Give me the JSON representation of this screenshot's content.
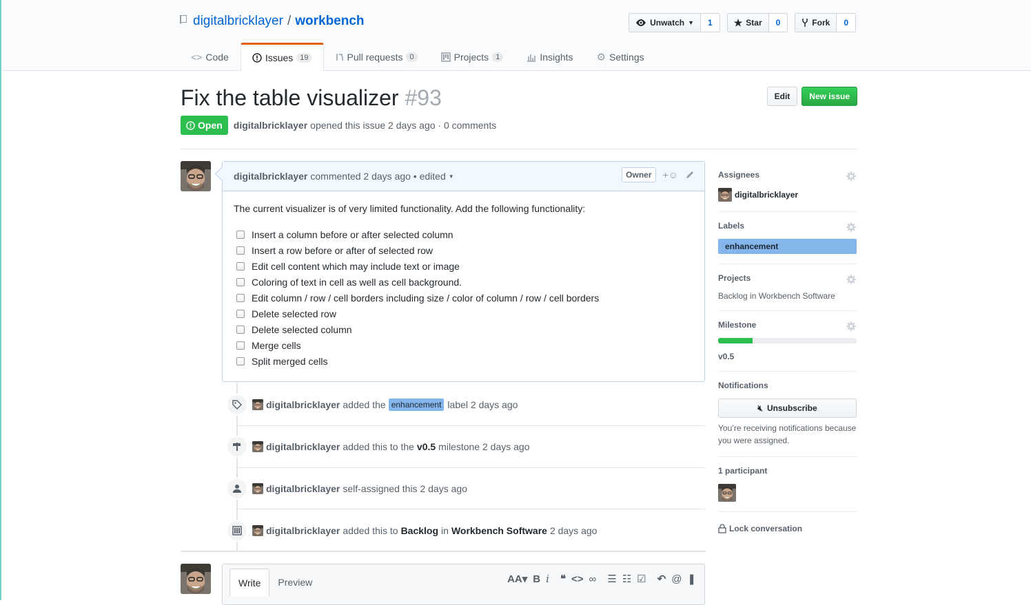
{
  "repo": {
    "owner": "digitalbricklayer",
    "separator": "/",
    "name": "workbench"
  },
  "actions": {
    "watch": {
      "label": "Unwatch",
      "count": "1"
    },
    "star": {
      "label": "Star",
      "count": "0"
    },
    "fork": {
      "label": "Fork",
      "count": "0"
    }
  },
  "nav": [
    {
      "label": "Code"
    },
    {
      "label": "Issues",
      "counter": "19"
    },
    {
      "label": "Pull requests",
      "counter": "0"
    },
    {
      "label": "Projects",
      "counter": "1"
    },
    {
      "label": "Insights"
    },
    {
      "label": "Settings"
    }
  ],
  "issue": {
    "title": "Fix the table visualizer",
    "number": "#93",
    "edit_label": "Edit",
    "new_issue_label": "New issue",
    "state": "Open",
    "author": "digitalbricklayer",
    "meta": "opened this issue 2 days ago · 0 comments"
  },
  "comment": {
    "author": "digitalbricklayer",
    "meta": "commented 2 days ago • edited",
    "owner_label": "Owner",
    "intro": "The current visualizer is of very limited functionality. Add the following functionality:",
    "tasks": [
      "Insert a column before or after selected column",
      "Insert a row before or after of selected row",
      "Edit cell content which may include text or image",
      "Coloring of text in cell as well as cell background.",
      "Edit column / row / cell borders including size / color of column / row / cell borders",
      "Delete selected row",
      "Delete selected column",
      "Merge cells",
      "Split merged cells"
    ]
  },
  "events": [
    {
      "who": "digitalbricklayer",
      "a": "added the",
      "label": "enhancement",
      "b": "label 2 days ago"
    },
    {
      "who": "digitalbricklayer",
      "a": "added this to the",
      "emph": "v0.5",
      "b": "milestone 2 days ago"
    },
    {
      "who": "digitalbricklayer",
      "a": "self-assigned this 2 days ago"
    },
    {
      "who": "digitalbricklayer",
      "a": "added this to",
      "emph": "Backlog",
      "mid": "in",
      "emph2": "Workbench Software",
      "b": "2 days ago"
    }
  ],
  "newcomment": {
    "write": "Write",
    "preview": "Preview"
  },
  "sidebar": {
    "assignees": {
      "heading": "Assignees",
      "user": "digitalbricklayer"
    },
    "labels": {
      "heading": "Labels",
      "label": "enhancement",
      "color": "#84b6eb"
    },
    "projects": {
      "heading": "Projects",
      "text": "Backlog in Workbench Software"
    },
    "milestone": {
      "heading": "Milestone",
      "progress": 0.25,
      "name": "v0.5"
    },
    "notifications": {
      "heading": "Notifications",
      "button": "Unsubscribe",
      "reason": "You’re receiving notifications because you were assigned."
    },
    "participants": {
      "heading": "1 participant"
    },
    "lock": "Lock conversation"
  },
  "colors": {
    "accent": "#0366d6",
    "open": "#2cbe4e",
    "tab_active": "#e36209"
  }
}
